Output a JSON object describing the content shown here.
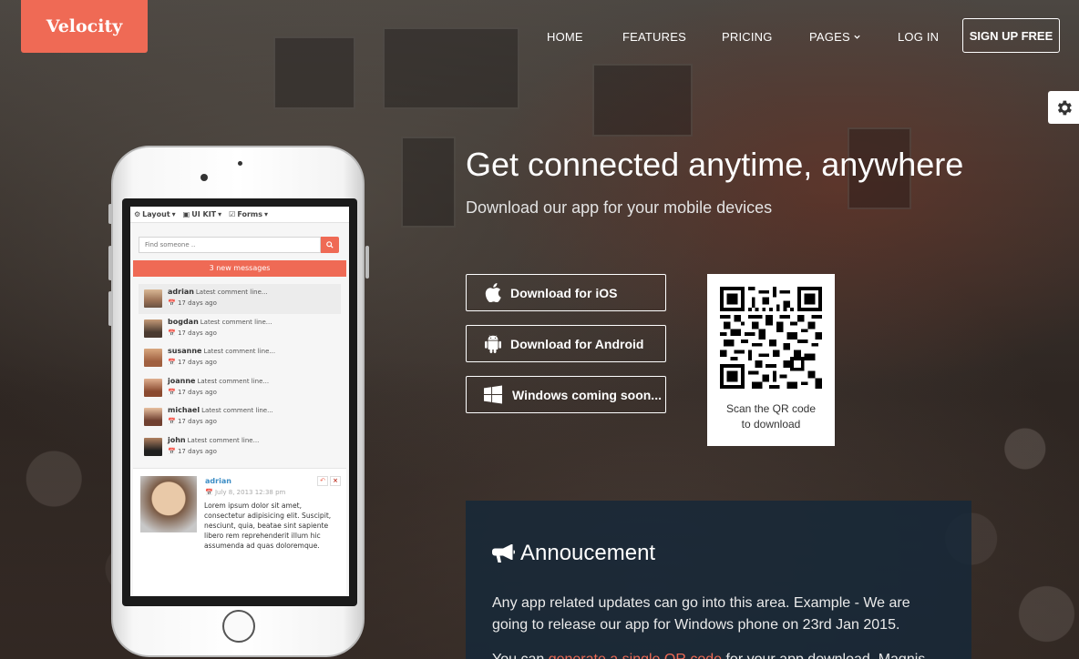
{
  "brand": "Velocity",
  "nav": {
    "items": [
      "HOME",
      "FEATURES",
      "PRICING",
      "PAGES",
      "LOG IN"
    ],
    "signup": "SIGN UP FREE"
  },
  "hero": {
    "title": "Get connected anytime, anywhere",
    "subtitle": "Download our app for your mobile devices"
  },
  "downloads": {
    "ios": "Download for iOS",
    "android": "Download for Android",
    "windows": "Windows coming soon..."
  },
  "qr": {
    "caption_line1": "Scan the QR code",
    "caption_line2": "to download"
  },
  "announcement": {
    "title": "Annoucement",
    "paragraph1": "Any app related updates can go into this area. Example - We are going to release our app for Windows phone on 23rd Jan 2015.",
    "paragraph2_prefix": "You can ",
    "paragraph2_link": "generate a single QR code",
    "paragraph2_suffix": " for your app download. Magnis"
  },
  "phone_screen": {
    "nav": [
      "Layout",
      "UI KIT",
      "Forms"
    ],
    "search_placeholder": "Find someone ..",
    "banner": "3 new messages",
    "messages": [
      {
        "name": "adrian",
        "preview": "Latest comment line...",
        "time": "17 days ago"
      },
      {
        "name": "bogdan",
        "preview": "Latest comment line...",
        "time": "17 days ago"
      },
      {
        "name": "susanne",
        "preview": "Latest comment line...",
        "time": "17 days ago"
      },
      {
        "name": "joanne",
        "preview": "Latest comment line...",
        "time": "17 days ago"
      },
      {
        "name": "michael",
        "preview": "Latest comment line...",
        "time": "17 days ago"
      },
      {
        "name": "john",
        "preview": "Latest comment line...",
        "time": "17 days ago"
      }
    ],
    "detail": {
      "name": "adrian",
      "date": "July 8, 2013 12:38 pm",
      "text": "Lorem ipsum dolor sit amet, consectetur adipisicing elit. Suscipit, nesciunt, quia, beatae sint sapiente libero rem reprehenderit illum hic assumenda ad quas doloremque."
    }
  },
  "colors": {
    "brand": "#ef6a55",
    "announcement_bg": "#162838",
    "link": "#3c8dc5"
  }
}
